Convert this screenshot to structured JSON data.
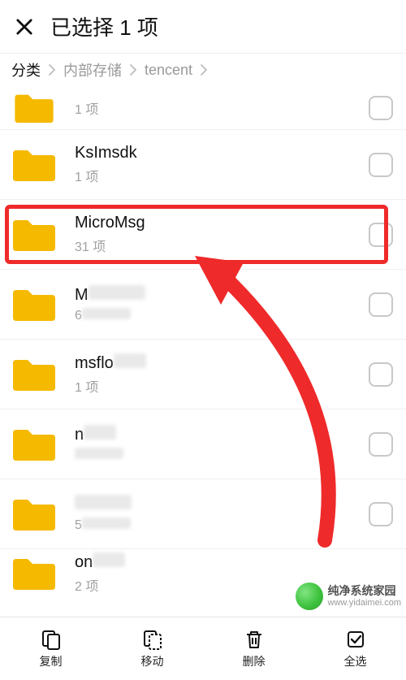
{
  "header": {
    "title": "已选择 1 项"
  },
  "breadcrumb": {
    "items": [
      "分类",
      "内部存储",
      "tencent"
    ],
    "active_index": 0
  },
  "folders": [
    {
      "name": "",
      "sub": "1 项",
      "partial_top": true
    },
    {
      "name": "KsImsdk",
      "sub": "1 项"
    },
    {
      "name": "MicroMsg",
      "sub": "31 项",
      "highlighted": true
    },
    {
      "name_prefix": "M",
      "sub_prefix": "6",
      "censored": true
    },
    {
      "name_prefix": "msflo",
      "sub": "1 项",
      "censored_tail": true
    },
    {
      "name_prefix": "n",
      "censored": true
    },
    {
      "name_prefix": "",
      "sub_prefix": "5",
      "censored": true
    },
    {
      "name_prefix": "on",
      "sub": "2 项",
      "censored_tail": true,
      "partial_bottom": true
    }
  ],
  "actions": {
    "copy": "复制",
    "move": "移动",
    "delete": "删除",
    "select_all": "全选"
  },
  "watermark": {
    "line1": "纯净系统家园",
    "line2": "www.yidaimei.com"
  },
  "colors": {
    "folder": "#f5b900",
    "highlight": "#ef2a2a"
  }
}
